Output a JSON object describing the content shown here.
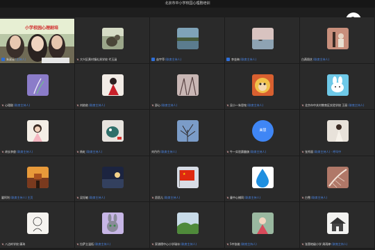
{
  "window": {
    "title": "北京市中小学校园心理剧培训"
  },
  "video_caption": "小学校园心理剧培",
  "participants": [
    {
      "name": "朱淑云",
      "role": "(主持人)",
      "marker": "box",
      "avatar": "video"
    },
    {
      "name": "大兴区黄村镇礼贤学校 代玉涵",
      "role": "",
      "marker": "mic",
      "avatar": "cat"
    },
    {
      "name": "苗宇萍",
      "role": "(联席主持人)",
      "marker": "box",
      "avatar": "lake"
    },
    {
      "name": "李金梅",
      "role": "(联席主持人)",
      "marker": "box",
      "avatar": "sea"
    },
    {
      "name": "白燕翔艺",
      "role": "(联席主持人)",
      "marker": "none",
      "avatar": "figure"
    },
    {
      "name": "心理剧",
      "role": "(联席主持人)",
      "marker": "mic",
      "avatar": "lavender"
    },
    {
      "name": "刘依依",
      "role": "(联席主持人)",
      "marker": "mic",
      "avatar": "redgirl"
    },
    {
      "name": "邵心",
      "role": "(联席主持人)",
      "marker": "mic",
      "avatar": "tree"
    },
    {
      "name": "吴小一朱思铭",
      "role": "(联席主持人)",
      "marker": "mic",
      "avatar": "monkey"
    },
    {
      "name": "北京市中关村教育区实验学校 王丽",
      "role": "(联席主持人)",
      "marker": "mic",
      "avatar": "rabbit"
    },
    {
      "name": "胡长李俊",
      "role": "(联席主持人)",
      "marker": "mic",
      "avatar": "girl"
    },
    {
      "name": "杨虹",
      "role": "(联席主持人)",
      "marker": "mic",
      "avatar": "toy"
    },
    {
      "name": "刘丹丹",
      "role": "(联席主持人)",
      "marker": "none",
      "avatar": "branches"
    },
    {
      "name": "牛一实验赛趣旗",
      "role": "(联席主持人)",
      "marker": "mic",
      "avatar": "circle",
      "circle_text": "美慧"
    },
    {
      "name": "张秀丽",
      "role": "(联席主持人) - 呼叫中",
      "marker": "mic",
      "avatar": "woman"
    },
    {
      "name": "翟阿利",
      "role": "(联席主持人) 主页",
      "marker": "none",
      "avatar": "gate"
    },
    {
      "name": "吴钰敏",
      "role": "(联席主持人)",
      "marker": "mic",
      "avatar": "sunset"
    },
    {
      "name": "愿愿儿",
      "role": "(联席主持人)",
      "marker": "mic",
      "avatar": "flag"
    },
    {
      "name": "童中心捕同",
      "role": "(联席主持人)",
      "marker": "mic",
      "avatar": "drop"
    },
    {
      "name": "白雪",
      "role": "(联席主持人)",
      "marker": "mic",
      "avatar": "feather"
    },
    {
      "name": "八达岭学校 康玮",
      "role": "",
      "marker": "mic",
      "avatar": "sketch"
    },
    {
      "name": "拉萨立温拓",
      "role": "(联席主持人)",
      "marker": "mic",
      "avatar": "bunny"
    },
    {
      "name": "家骐德中心小学瑞冰",
      "role": "(联席主持人)",
      "marker": "mic",
      "avatar": "hills"
    },
    {
      "name": "5中张姚",
      "role": "(联席主持人)",
      "marker": "mic",
      "avatar": "child"
    },
    {
      "name": "张营地级小学 周雨婷",
      "role": "(联席主持人)",
      "marker": "mic",
      "avatar": "house"
    }
  ],
  "controls": {
    "zoom_icon": "zoom-in-icon"
  },
  "colors": {
    "background": "#1e1e1e",
    "tile": "#2a2a2a",
    "role_text": "#4a86e8",
    "host_marker": "#2f6fd8"
  }
}
